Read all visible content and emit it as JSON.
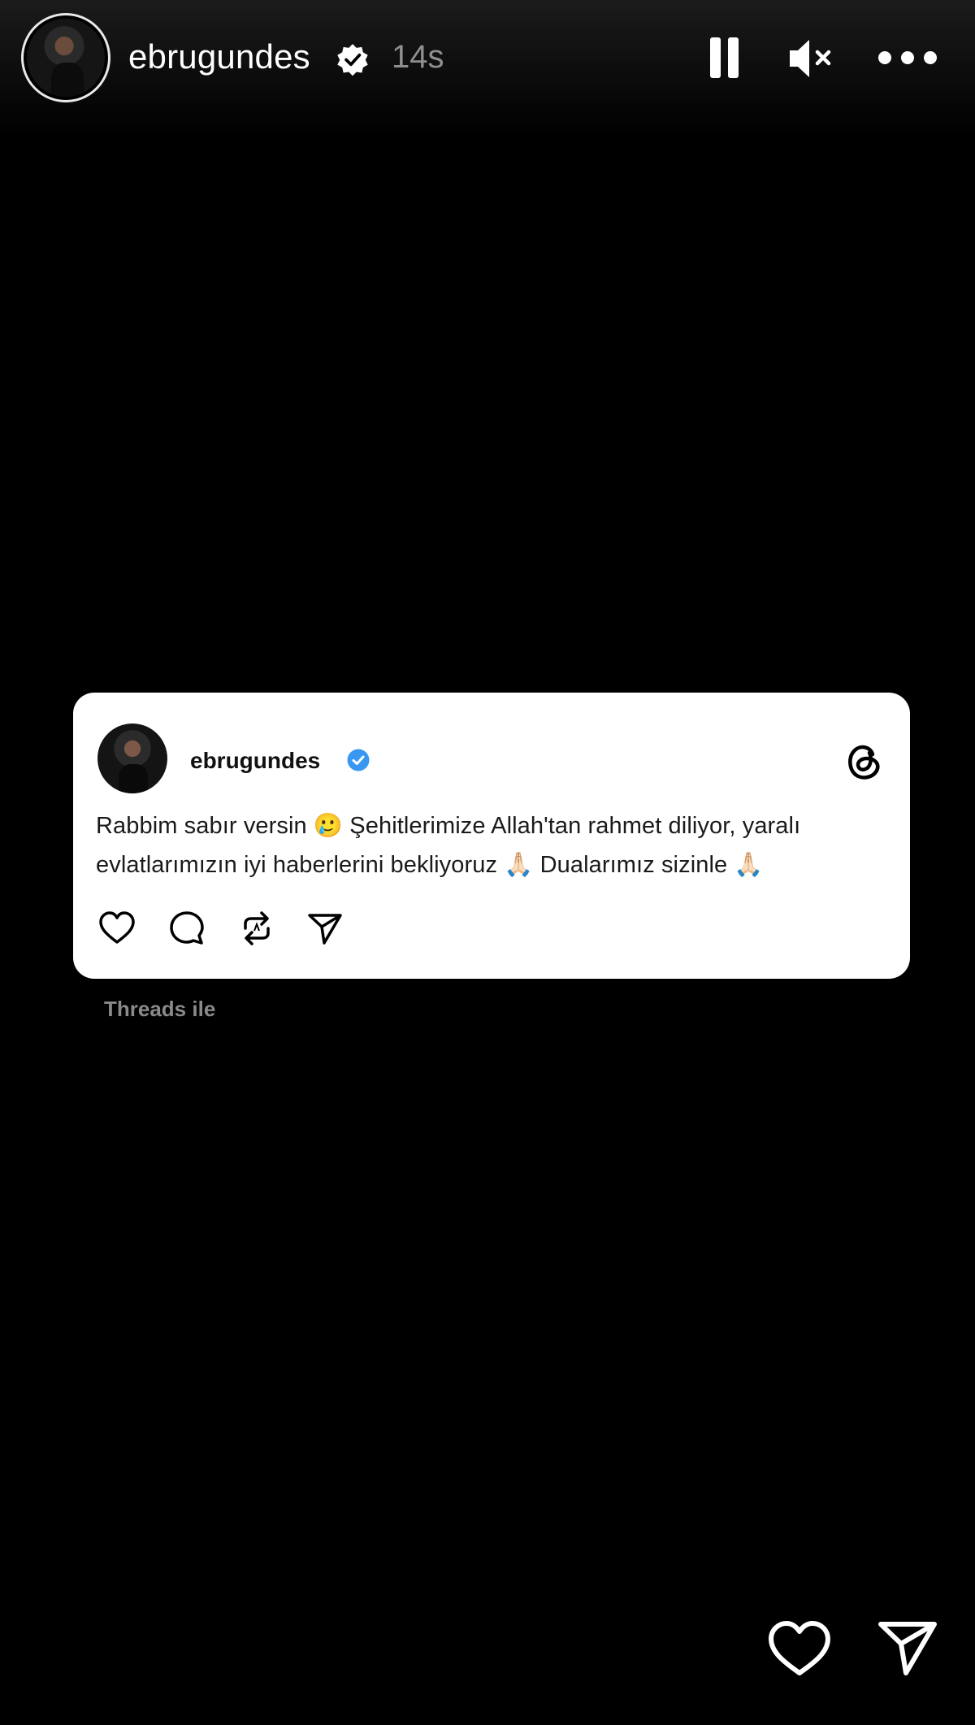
{
  "story": {
    "username": "ebrugundes",
    "time": "14s"
  },
  "post": {
    "username": "ebrugundes",
    "text": "Rabbim sabır versin 🥲 Şehitlerimize Allah'tan rahmet diliyor, yaralı evlatlarımızın iyi haberlerini bekliyoruz 🙏🏻 Dualarımız sizinle 🙏🏻",
    "source_caption": "Threads ile"
  },
  "icons": {
    "pause": "pause-icon",
    "mute": "mute-icon",
    "more": "more-icon",
    "verified": "verified-icon",
    "threads": "threads-logo-icon",
    "like": "heart-icon",
    "comment": "comment-icon",
    "repost": "repost-icon",
    "share": "send-icon"
  },
  "colors": {
    "background": "#000000",
    "card": "#ffffff",
    "verified_blue": "#3897f0",
    "secondary_text": "#8f8f8f"
  }
}
